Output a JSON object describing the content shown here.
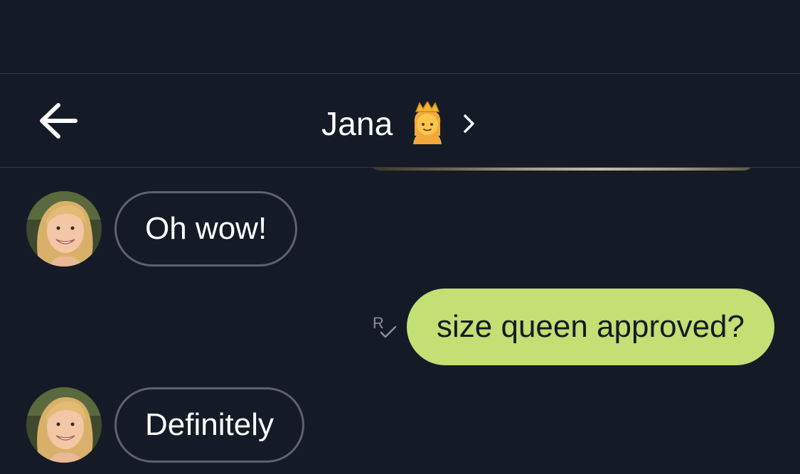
{
  "chat": {
    "title": "Jana",
    "title_emoji_icon": "princess-emoji-icon"
  },
  "messages": [
    {
      "direction": "incoming",
      "text": "Oh wow!"
    },
    {
      "direction": "outgoing",
      "text": "size queen approved?",
      "receipt": "R"
    },
    {
      "direction": "incoming",
      "text": "Definitely"
    }
  ],
  "colors": {
    "background": "#151b26",
    "outgoing_bubble": "#c2e073",
    "incoming_border": "#5d626c",
    "divider": "#323844"
  }
}
